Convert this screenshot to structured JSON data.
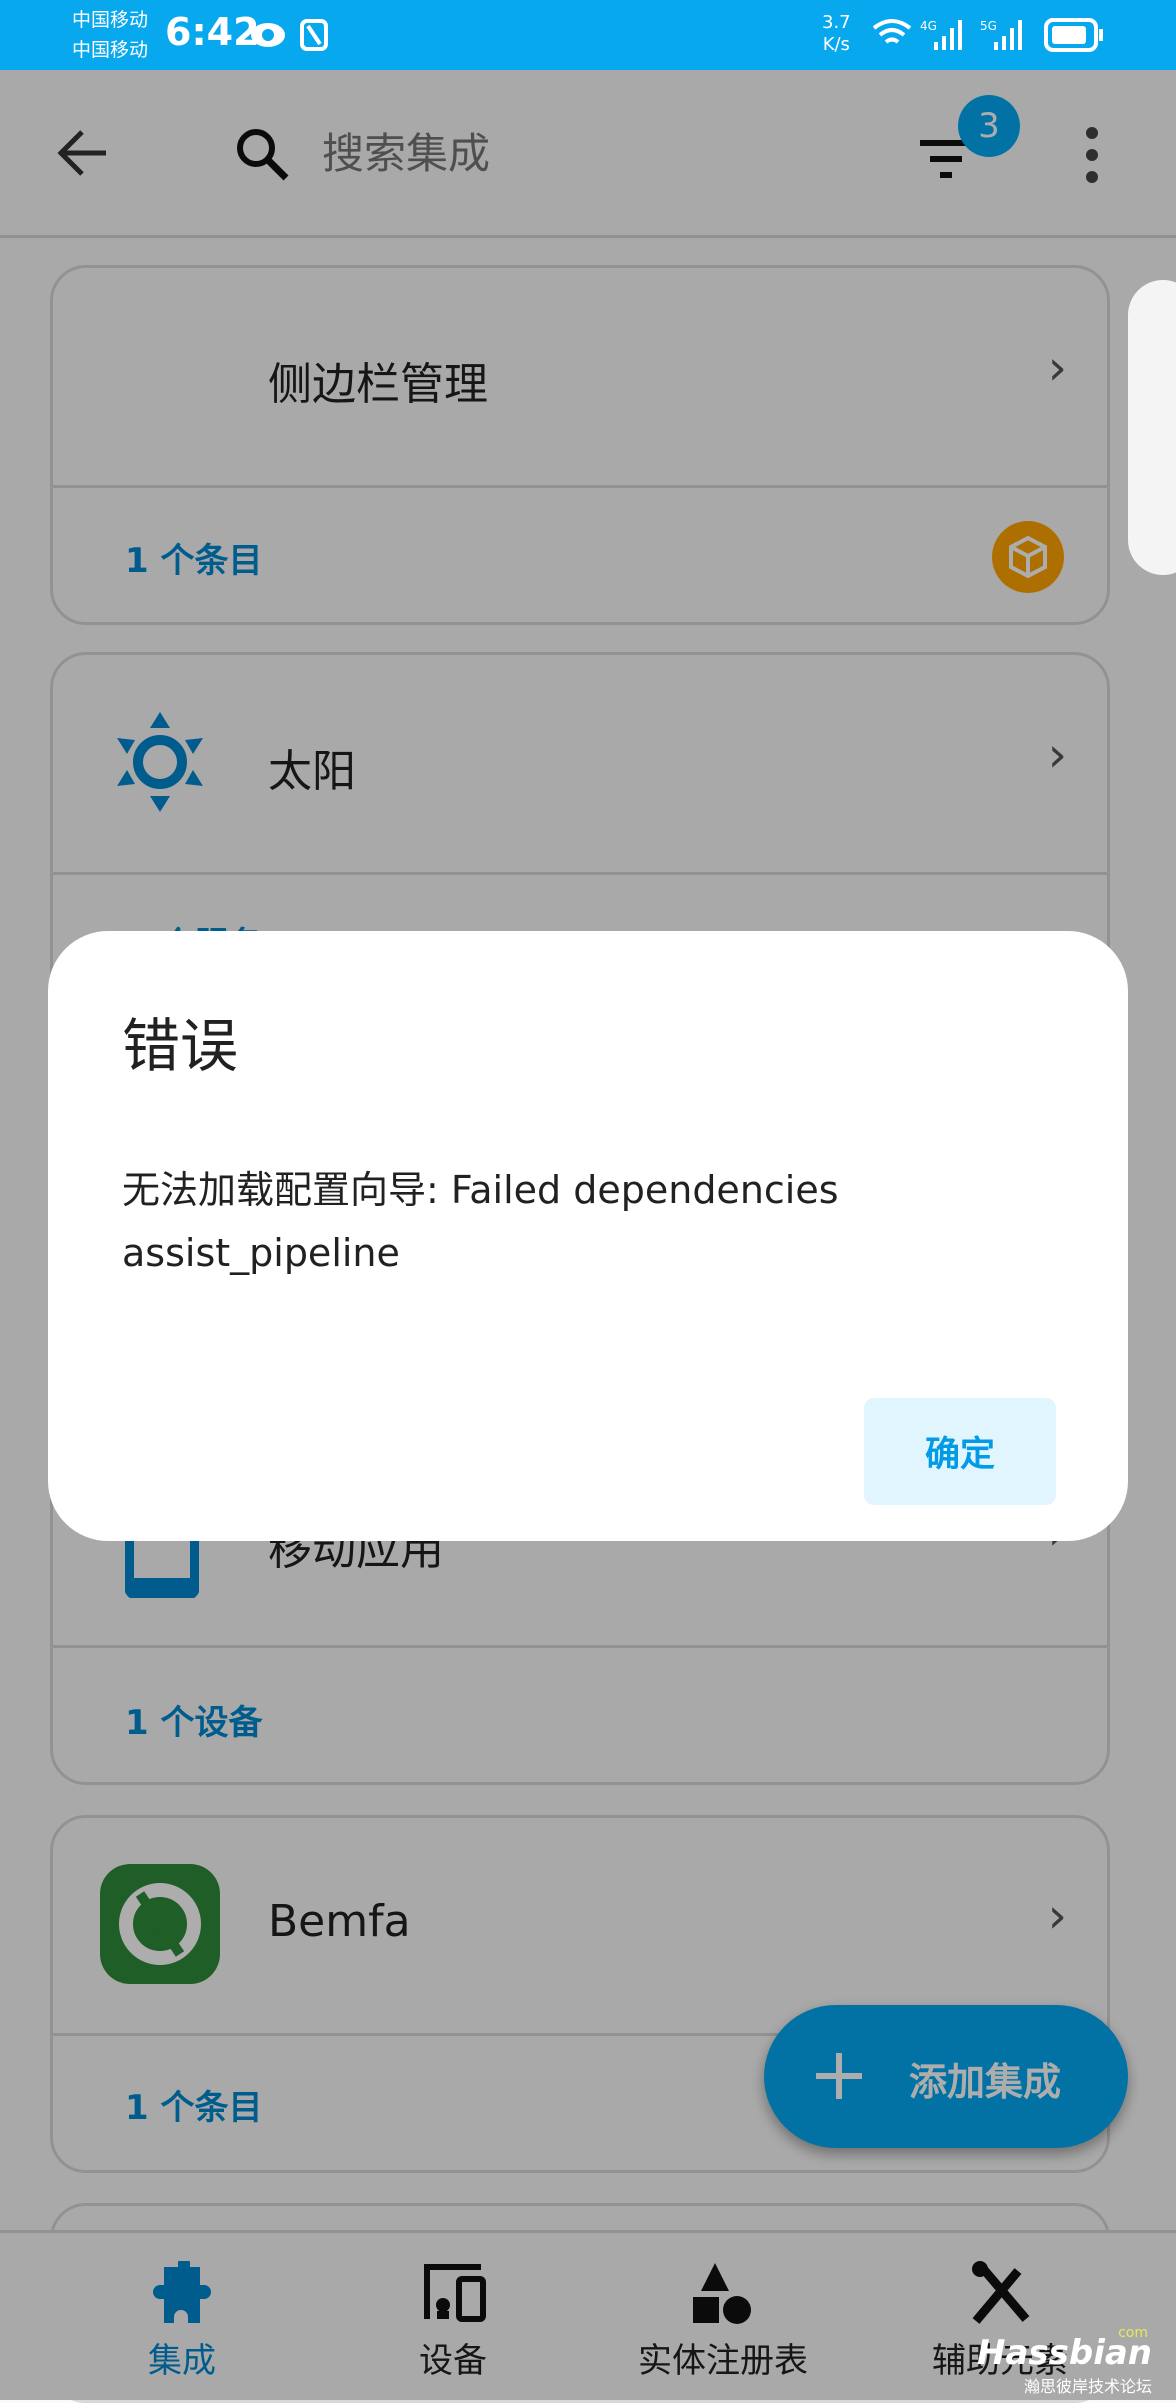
{
  "status_bar": {
    "carrier1": "中国移动",
    "carrier2": "中国移动",
    "time": "6:42",
    "net_speed_value": "3.7",
    "net_speed_unit": "K/s",
    "signal1": "4G",
    "signal2": "5G",
    "color": "#08a8ef"
  },
  "app_bar": {
    "search_placeholder": "搜索集成",
    "filter_count": "3"
  },
  "cards": [
    {
      "title": "侧边栏管理",
      "footer": "1 个条目",
      "badge_icon": "package-icon"
    },
    {
      "title": "太阳",
      "footer": "1 个服务",
      "icon": "sun-icon"
    },
    {
      "title": "移动应用",
      "footer": "1 个设备",
      "icon": "cellphone-icon"
    },
    {
      "title": "Bemfa",
      "footer": "1 个条目",
      "icon": "bemfa-logo"
    }
  ],
  "fab": {
    "label": "添加集成"
  },
  "bottom_nav": [
    {
      "label": "集成",
      "icon": "puzzle-icon",
      "active": true
    },
    {
      "label": "设备",
      "icon": "devices-icon"
    },
    {
      "label": "实体注册表",
      "icon": "shapes-icon"
    },
    {
      "label": "辅助元素",
      "icon": "tools-icon"
    }
  ],
  "dialog": {
    "title": "错误",
    "message": "无法加载配置向导: Failed dependencies assist_pipeline",
    "confirm": "确定"
  },
  "watermark": {
    "brand": "Hassbian",
    "suffix": "com",
    "tagline": "瀚思彼岸技术论坛"
  },
  "colors": {
    "accent": "#03a9f4",
    "link": "#0288d1",
    "bemfa": "#2e8b3a",
    "badge": "#ffa600"
  }
}
